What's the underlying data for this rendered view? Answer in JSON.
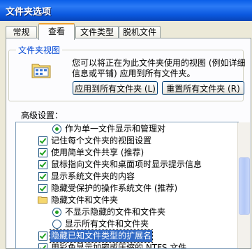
{
  "window": {
    "title": "文件夹选项"
  },
  "tabs": [
    {
      "label": "常规"
    },
    {
      "label": "查看"
    },
    {
      "label": "文件类型"
    },
    {
      "label": "脱机文件"
    }
  ],
  "folder_view": {
    "legend": "文件夹视图",
    "description": "您可以将正在为此文件夹使用的视图 (例如详细信息或平铺) 应用到所有文件夹。",
    "apply_all_label": "应用到所有文件夹 (L)",
    "reset_all_label": "重置所有文件夹 (R)"
  },
  "advanced": {
    "label": "高级设置：",
    "items": [
      {
        "type": "radio",
        "checked": true,
        "text": "作为单一文件显示和管理对"
      },
      {
        "type": "checkbox",
        "checked": true,
        "text": "记住每个文件夹的视图设置"
      },
      {
        "type": "checkbox",
        "checked": true,
        "text": "使用简单文件共享 (推荐)"
      },
      {
        "type": "checkbox",
        "checked": true,
        "text": "鼠标指向文件夹和桌面项时显示提示信息"
      },
      {
        "type": "checkbox",
        "checked": true,
        "text": "显示系统文件夹的内容"
      },
      {
        "type": "checkbox",
        "checked": true,
        "text": "隐藏受保护的操作系统文件 (推荐)"
      },
      {
        "type": "folder",
        "text": "隐藏文件和文件夹"
      },
      {
        "type": "radio",
        "checked": true,
        "text": "不显示隐藏的文件和文件夹"
      },
      {
        "type": "radio",
        "checked": false,
        "text": "显示所有文件和文件夹"
      },
      {
        "type": "checkbox",
        "checked": true,
        "text": "隐藏已知文件类型的扩展名",
        "selected": true
      },
      {
        "type": "checkbox",
        "checked": true,
        "text": "用彩色显示加密或压缩的 NTFS 文件"
      }
    ]
  }
}
